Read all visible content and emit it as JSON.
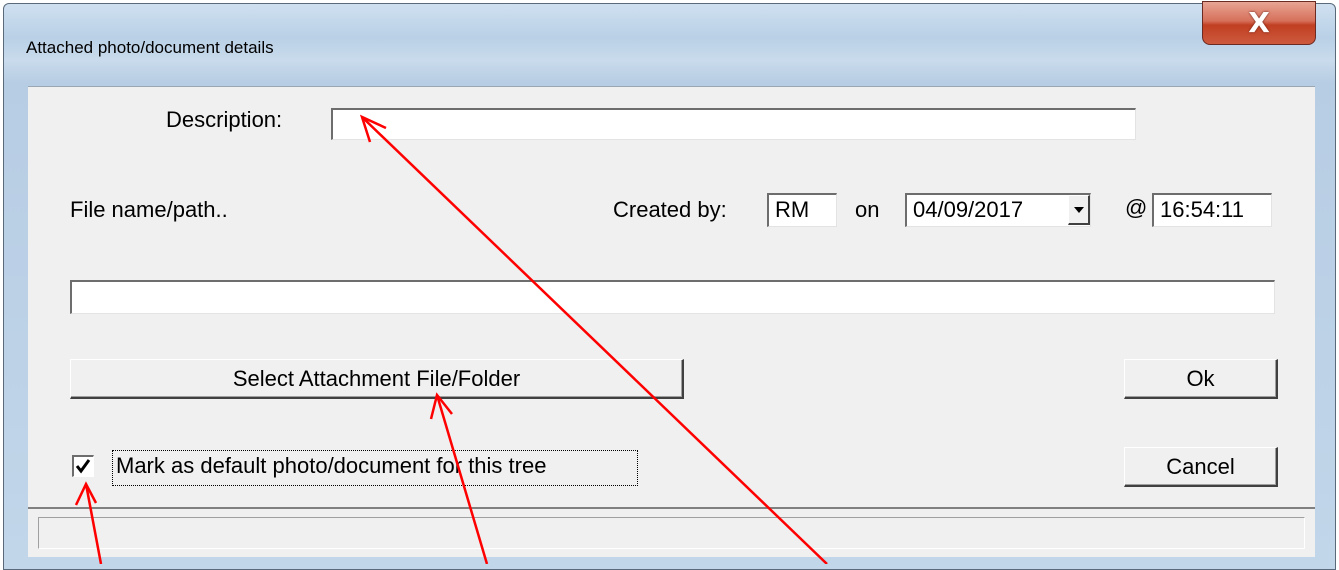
{
  "window": {
    "title": "Attached photo/document details",
    "close_glyph": "X"
  },
  "form": {
    "description_label": "Description:",
    "description_value": "",
    "file_label": "File name/path..",
    "created_by_label": "Created by:",
    "created_by_value": "RM",
    "on_label": "on",
    "date_value": "04/09/2017",
    "at_label": "@",
    "time_value": "16:54:11",
    "file_path_value": "",
    "select_button": "Select Attachment File/Folder",
    "ok_button": "Ok",
    "cancel_button": "Cancel",
    "default_checkbox_label": "Mark as default photo/document for this tree",
    "default_checked": true
  },
  "annotation": {
    "arrow_color": "#ff0000"
  }
}
